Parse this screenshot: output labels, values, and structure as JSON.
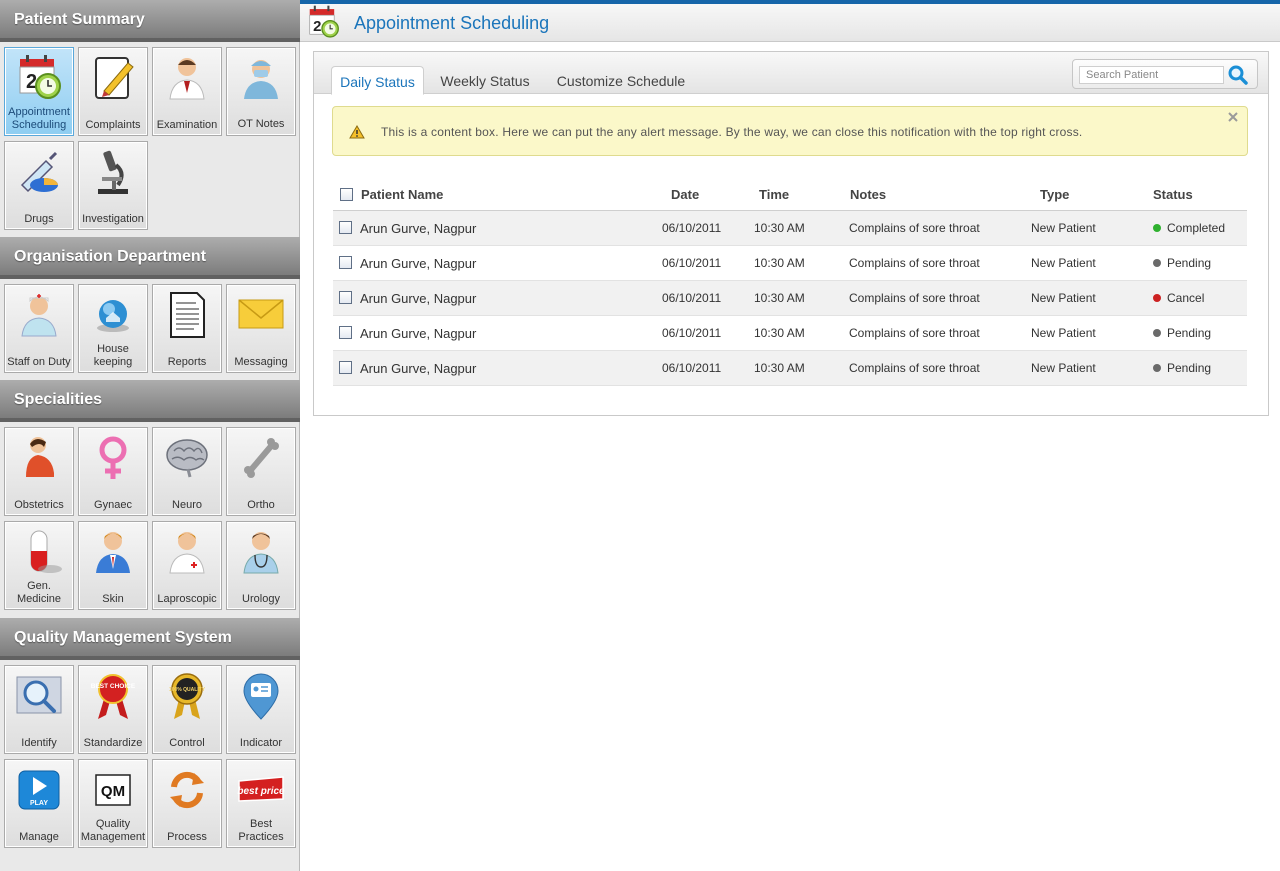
{
  "sidebar": {
    "sections": [
      {
        "title": "Patient Summary",
        "tiles": [
          {
            "label": "Appointment Scheduling",
            "icon": "calendar-clock-icon",
            "active": true
          },
          {
            "label": "Complaints",
            "icon": "notepad-pencil-icon"
          },
          {
            "label": "Examination",
            "icon": "doctor-icon"
          },
          {
            "label": "OT Notes",
            "icon": "surgeon-icon"
          },
          {
            "label": "Drugs",
            "icon": "syringe-pill-icon"
          },
          {
            "label": "Investigation",
            "icon": "microscope-icon"
          }
        ]
      },
      {
        "title": "Organisation Department",
        "tiles": [
          {
            "label": "Staff on Duty",
            "icon": "nurse-icon"
          },
          {
            "label": "House keeping",
            "icon": "house-sphere-icon"
          },
          {
            "label": "Reports",
            "icon": "document-icon"
          },
          {
            "label": "Messaging",
            "icon": "envelope-icon"
          }
        ]
      },
      {
        "title": "Specialities",
        "tiles": [
          {
            "label": "Obstetrics",
            "icon": "pregnant-woman-icon"
          },
          {
            "label": "Gynaec",
            "icon": "female-symbol-icon"
          },
          {
            "label": "Neuro",
            "icon": "brain-icon"
          },
          {
            "label": "Ortho",
            "icon": "bone-icon"
          },
          {
            "label": "Gen. Medicine",
            "icon": "capsule-icon"
          },
          {
            "label": "Skin",
            "icon": "man-suit-icon"
          },
          {
            "label": "Laproscopic",
            "icon": "medic-icon"
          },
          {
            "label": "Urology",
            "icon": "doctor-stethoscope-icon"
          }
        ]
      },
      {
        "title": "Quality Management System",
        "tiles": [
          {
            "label": "Identify",
            "icon": "magnifier-icon"
          },
          {
            "label": "Standardize",
            "icon": "best-choice-badge-icon"
          },
          {
            "label": "Control",
            "icon": "quality-medal-icon"
          },
          {
            "label": "Indicator",
            "icon": "id-card-pin-icon"
          },
          {
            "label": "Manage",
            "icon": "play-button-icon"
          },
          {
            "label": "Quality Management",
            "icon": "qm-logo-icon"
          },
          {
            "label": "Process",
            "icon": "refresh-arrows-icon"
          },
          {
            "label": "Best Practices",
            "icon": "best-price-tag-icon"
          }
        ]
      }
    ],
    "badge_texts": {
      "best_choice": "BEST CHOICE",
      "quality": "100% QUALITY",
      "play": "PLAY",
      "qm": "QM",
      "best_price": "best price",
      "calendar_day": "2"
    }
  },
  "header": {
    "title": "Appointment Scheduling",
    "icon": "calendar-clock-icon"
  },
  "tabs": [
    {
      "label": "Daily Status",
      "active": true
    },
    {
      "label": "Weekly Status"
    },
    {
      "label": "Customize Schedule"
    }
  ],
  "search": {
    "placeholder": "Search Patient",
    "value": "",
    "icon": "search-icon"
  },
  "alert": {
    "text": "This is a content box. Here we can put the any alert message. By the way, we can close this notification with the top right cross.",
    "icon": "warning-icon",
    "close_icon": "close-icon"
  },
  "table": {
    "headers": [
      "Patient Name",
      "Date",
      "Time",
      "Notes",
      "Type",
      "Status"
    ],
    "rows": [
      {
        "name": "Arun Gurve, Nagpur",
        "date": "06/10/2011",
        "time": "10:30 AM",
        "notes": "Complains of sore throat",
        "type": "New Patient",
        "status": "Completed",
        "status_color": "#2fb12f"
      },
      {
        "name": "Arun Gurve, Nagpur",
        "date": "06/10/2011",
        "time": "10:30 AM",
        "notes": "Complains of sore throat",
        "type": "New Patient",
        "status": "Pending",
        "status_color": "#6a6a6a"
      },
      {
        "name": "Arun Gurve, Nagpur",
        "date": "06/10/2011",
        "time": "10:30 AM",
        "notes": "Complains of sore throat",
        "type": "New Patient",
        "status": "Cancel",
        "status_color": "#cc2222"
      },
      {
        "name": "Arun Gurve, Nagpur",
        "date": "06/10/2011",
        "time": "10:30 AM",
        "notes": "Complains of sore throat",
        "type": "New Patient",
        "status": "Pending",
        "status_color": "#6a6a6a"
      },
      {
        "name": "Arun Gurve, Nagpur",
        "date": "06/10/2011",
        "time": "10:30 AM",
        "notes": "Complains of sore throat",
        "type": "New Patient",
        "status": "Pending",
        "status_color": "#6a6a6a"
      }
    ]
  },
  "colors": {
    "accent": "#1b75bb",
    "top_bar": "#1565a9",
    "alert_bg": "#fbf8c9"
  }
}
